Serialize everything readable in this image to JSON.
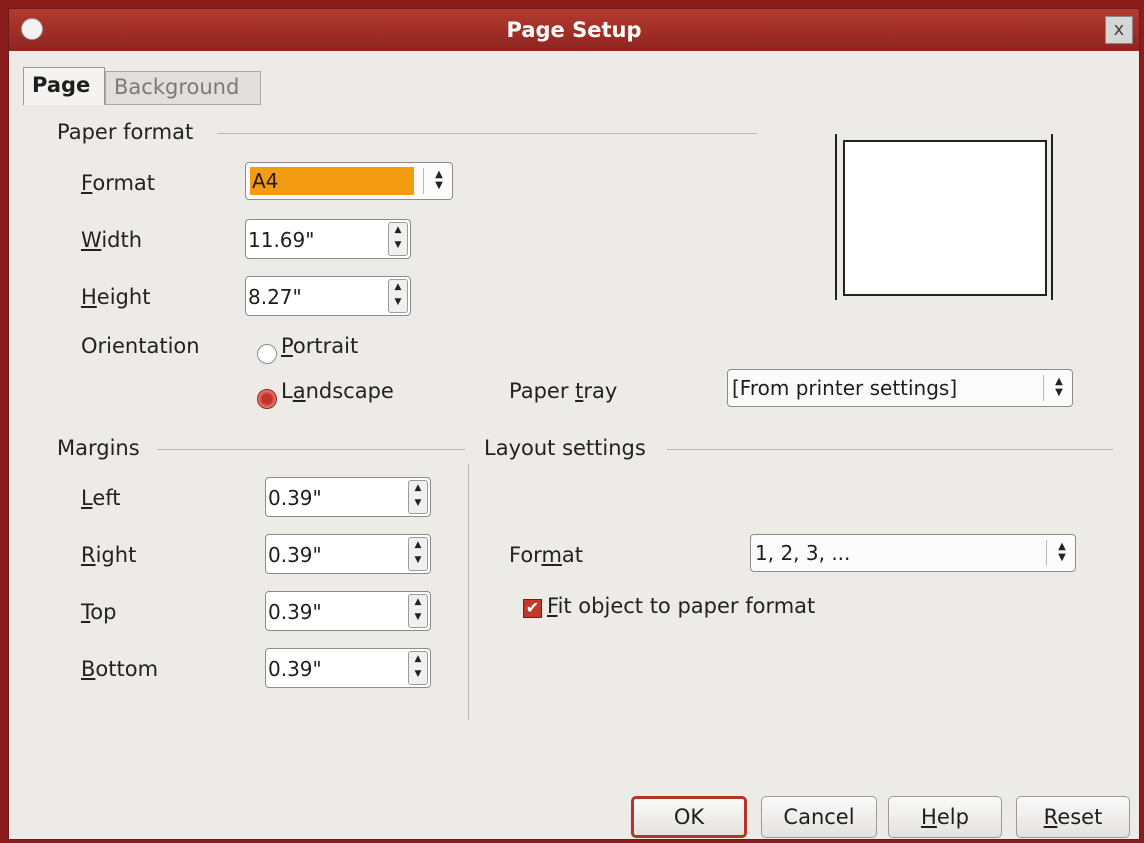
{
  "window": {
    "title": "Page Setup",
    "close_label": "x"
  },
  "tabs": [
    {
      "label": "Page",
      "active": true
    },
    {
      "label": "Background",
      "active": false
    }
  ],
  "paper_format": {
    "section_label": "Paper format",
    "format": {
      "label_u": "F",
      "label_rest": "ormat",
      "value": "A4"
    },
    "width": {
      "label_u": "W",
      "label_rest": "idth",
      "value": "11.69\""
    },
    "height": {
      "label_u": "H",
      "label_rest": "eight",
      "value": "8.27\""
    },
    "orientation": {
      "label": "Orientation",
      "portrait_u": "P",
      "portrait_rest": "ortrait",
      "landscape_pre": "L",
      "landscape_u": "a",
      "landscape_rest": "ndscape",
      "selected": "Landscape"
    },
    "paper_tray": {
      "label_pre": "Paper ",
      "label_u": "t",
      "label_rest": "ray",
      "value": "[From printer settings]"
    }
  },
  "margins": {
    "section_label": "Margins",
    "left": {
      "label_u": "L",
      "label_rest": "eft",
      "value": "0.39\""
    },
    "right": {
      "label_u": "R",
      "label_rest": "ight",
      "value": "0.39\""
    },
    "top": {
      "label_u": "T",
      "label_rest": "op",
      "value": "0.39\""
    },
    "bottom": {
      "label_u": "B",
      "label_rest": "ottom",
      "value": "0.39\""
    }
  },
  "layout_settings": {
    "section_label": "Layout settings",
    "format": {
      "label_pre": "For",
      "label_u": "m",
      "label_rest": "at",
      "value": "1, 2, 3, ..."
    },
    "fit_object": {
      "label_u": "F",
      "label_rest": "it object to paper format",
      "checked": true
    }
  },
  "buttons": {
    "ok": "OK",
    "cancel": "Cancel",
    "help_u": "H",
    "help_rest": "elp",
    "reset_u": "R",
    "reset_rest": "eset"
  },
  "colors": {
    "accent": "#c0392b",
    "selection": "#f39c12",
    "titlebar": "#a8312a"
  }
}
